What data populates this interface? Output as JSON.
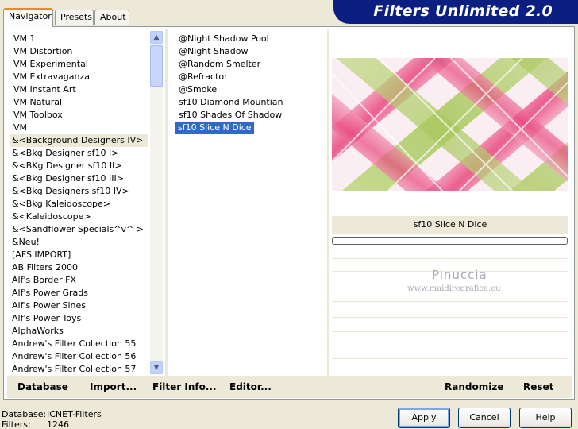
{
  "tabs": [
    "Navigator",
    "Presets",
    "About"
  ],
  "app_title": "Filters Unlimited 2.0",
  "categories": [
    "VM 1",
    "VM Distortion",
    "VM Experimental",
    "VM Extravaganza",
    "VM Instant Art",
    "VM Natural",
    "VM Toolbox",
    "VM",
    "&<Background Designers IV>",
    "&<Bkg Designer sf10 I>",
    "&<BKg Designer sf10 II>",
    "&<Bkg Designer sf10 III>",
    "&<Bkg Designers sf10 IV>",
    "&<Bkg Kaleidoscope>",
    "&<Kaleidoscope>",
    "&<Sandflower Specials^v^ >",
    "&Neu!",
    "[AFS IMPORT]",
    "AB Filters 2000",
    "Alf's Border FX",
    "Alf's Power Grads",
    "Alf's Power Sines",
    "Alf's Power Toys",
    "AlphaWorks",
    "Andrew's Filter Collection 55",
    "Andrew's Filter Collection 56",
    "Andrew's Filter Collection 57"
  ],
  "selected_category_index": 8,
  "filters": [
    "@Night Shadow Pool",
    "@Night Shadow",
    "@Random Smelter",
    "@Refractor",
    "@Smoke",
    "sf10 Diamond Mountian",
    "sf10 Shades Of Shadow",
    "sf10 Slice N Dice"
  ],
  "selected_filter_index": 7,
  "preview": {
    "filter_name": "sf10 Slice N Dice",
    "watermark_name": "Pinuccia",
    "watermark_url": "www.maidiregrafica.eu"
  },
  "panel_buttons": {
    "database": "Database",
    "import": "Import...",
    "filter_info": "Filter Info...",
    "editor": "Editor...",
    "randomize": "Randomize",
    "reset": "Reset"
  },
  "footer": {
    "database_label": "Database:",
    "database_value": "ICNET-Filters",
    "filters_label": "Filters:",
    "filters_value": "1246"
  },
  "dialog_buttons": {
    "apply": "Apply",
    "cancel": "Cancel",
    "help": "Help"
  },
  "colors": {
    "banner": "#0a1f80",
    "selection": "#316ac5",
    "tab_accent": "#e68b2c",
    "preview_pink": "#e8467c",
    "preview_green": "#a7c75a"
  },
  "icons": {
    "scroll_up": "chevron-up-icon",
    "scroll_down": "chevron-down-icon"
  }
}
